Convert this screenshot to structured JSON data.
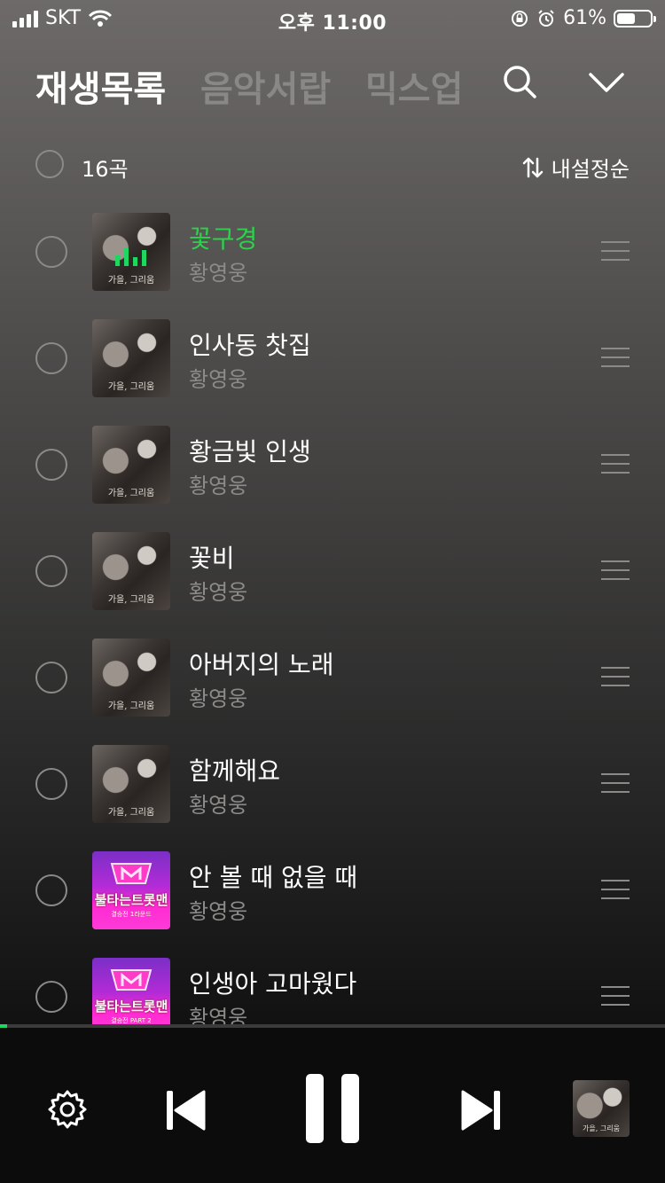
{
  "status_bar": {
    "carrier": "SKT",
    "time": "오후 11:00",
    "battery_text": "61%",
    "battery_level": 0.61
  },
  "header": {
    "tabs": [
      {
        "label": "재생목록",
        "active": true
      },
      {
        "label": "음악서랍",
        "active": false
      },
      {
        "label": "믹스업",
        "active": false
      }
    ],
    "icons": [
      "search-icon",
      "chevron-down-icon"
    ]
  },
  "list": {
    "count": "16곡",
    "sort_label": "내설정순",
    "songs": [
      {
        "title": "꽃구경",
        "artist": "황영웅",
        "art": "bw",
        "art_caption": "가을, 그리움",
        "playing": true
      },
      {
        "title": "인사동 찻집",
        "artist": "황영웅",
        "art": "bw",
        "art_caption": "가을, 그리움",
        "playing": false
      },
      {
        "title": "황금빛 인생",
        "artist": "황영웅",
        "art": "bw",
        "art_caption": "가을, 그리움",
        "playing": false
      },
      {
        "title": "꽃비",
        "artist": "황영웅",
        "art": "bw",
        "art_caption": "가을, 그리움",
        "playing": false
      },
      {
        "title": "아버지의 노래",
        "artist": "황영웅",
        "art": "bw",
        "art_caption": "가을, 그리움",
        "playing": false
      },
      {
        "title": "함께해요",
        "artist": "황영웅",
        "art": "bw",
        "art_caption": "가을, 그리움",
        "playing": false
      },
      {
        "title": "안 볼 때 없을 때",
        "artist": "황영웅",
        "art": "pink",
        "art_caption": "불타는트롯맨",
        "art_sub": "결승전 1라운드",
        "playing": false
      },
      {
        "title": "인생아 고마웠다",
        "artist": "황영웅",
        "art": "pink",
        "art_caption": "불타는트롯맨",
        "art_sub": "결승전 PART 2",
        "playing": false
      }
    ]
  },
  "player": {
    "progress": 0.01,
    "now_playing_art_caption": "가을, 그리움",
    "controls": [
      "settings-icon",
      "previous-icon",
      "pause-icon",
      "next-icon"
    ]
  },
  "colors": {
    "accent": "#1ed760",
    "playing_title": "#2bd34a",
    "muted": "#8c8b8a"
  }
}
